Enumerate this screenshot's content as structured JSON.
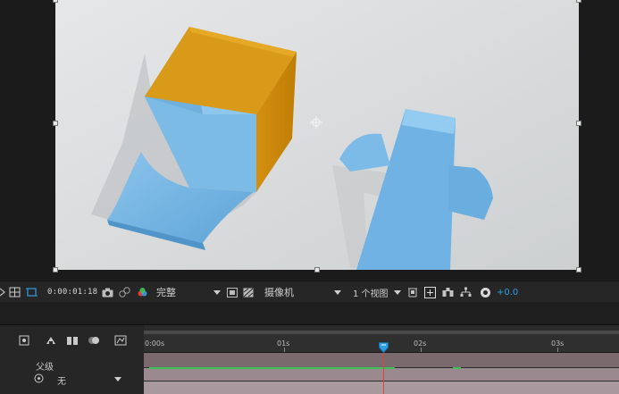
{
  "viewer": {
    "toolbar": {
      "timecode": "0:00:01:18",
      "resolution": "完整",
      "camera": "摄像机",
      "views": "1 个视图",
      "exposure": "+0.0"
    }
  },
  "timeline": {
    "ruler_labels": [
      "0:00s",
      "01s",
      "02s",
      "03s"
    ],
    "header": {
      "parent_label": "父级",
      "parent_value": "无"
    },
    "playhead_time": "0:00:01:18"
  },
  "colors": {
    "accent": "#2d9ee6",
    "playhead": "#e0433a",
    "cube_top": "#d89a18",
    "paper": "#6fb2e3"
  }
}
